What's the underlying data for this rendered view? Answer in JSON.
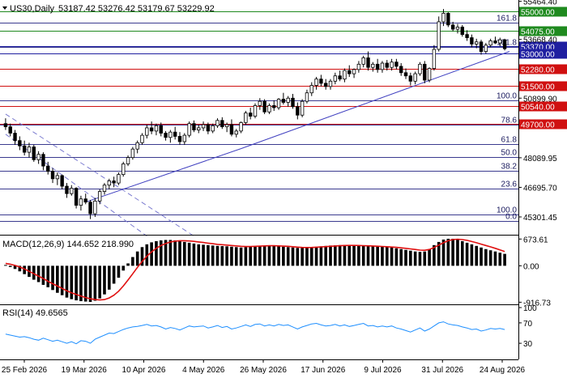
{
  "chart_data": {
    "type": "candlestick",
    "symbol_label": "US30,Daily",
    "ohlc_label": "53187.42 53276.42 53179.67 53229.92",
    "price_axis": {
      "range": [
        44500,
        55450
      ],
      "ticks": [
        {
          "value": 55464.4,
          "label": "55464.40"
        },
        {
          "value": 53668.4,
          "label": "53668.40"
        },
        {
          "value": 50899.9,
          "label": "50899.90"
        },
        {
          "value": 48089.95,
          "label": "48089.95"
        },
        {
          "value": 46695.7,
          "label": "46695.70"
        },
        {
          "value": 45301.45,
          "label": "45301.45"
        }
      ]
    },
    "horizontal_levels": [
      {
        "value": 55000,
        "label": "55000.00",
        "color": "#1f8a1f"
      },
      {
        "value": 54075,
        "label": "54075.00",
        "color": "#1f8a1f"
      },
      {
        "value": 53370,
        "label": "53370.00",
        "color": "#1f1fa0"
      },
      {
        "value": 53000,
        "label": "53000.00",
        "color": "#1f1fa0"
      },
      {
        "value": 52280,
        "label": "52280.00",
        "color": "#d01010"
      },
      {
        "value": 51500,
        "label": "51500.00",
        "color": "#d01010"
      },
      {
        "value": 50540,
        "label": "50540.00",
        "color": "#d01010"
      },
      {
        "value": 49700,
        "label": "49700.00",
        "color": "#d01010"
      }
    ],
    "fibonacci_levels": [
      {
        "label": "161.8",
        "value": 54450
      },
      {
        "label": "161.8",
        "value": 53330
      },
      {
        "label": "100.0",
        "value": 50780
      },
      {
        "label": "78.6",
        "value": 49640
      },
      {
        "label": "61.8",
        "value": 48730
      },
      {
        "label": "50.0",
        "value": 48110
      },
      {
        "label": "38.2",
        "value": 47460
      },
      {
        "label": "23.6",
        "value": 46640
      },
      {
        "label": "100.0",
        "value": 45420
      },
      {
        "label": "0.0",
        "value": 45110
      }
    ],
    "x_axis": {
      "labels": [
        "25 Feb 2026",
        "19 Mar 2026",
        "10 Apr 2026",
        "4 May 2026",
        "26 May 2026",
        "17 Jun 2026",
        "9 Jul 2026",
        "31 Jul 2026",
        "24 Aug 2026"
      ]
    },
    "candles": [
      [
        49700,
        49950,
        49400,
        49550
      ],
      [
        49550,
        49700,
        49100,
        49250
      ],
      [
        49250,
        49400,
        48700,
        48900
      ],
      [
        48900,
        49100,
        48450,
        48650
      ],
      [
        48650,
        48900,
        48200,
        48350
      ],
      [
        48350,
        48800,
        48100,
        48600
      ],
      [
        48600,
        48700,
        47900,
        48000
      ],
      [
        48000,
        48400,
        47800,
        48250
      ],
      [
        48250,
        48350,
        47500,
        47700
      ],
      [
        47700,
        47900,
        47300,
        47450
      ],
      [
        47450,
        47600,
        46900,
        47100
      ],
      [
        47100,
        47400,
        46800,
        47250
      ],
      [
        47250,
        47300,
        46600,
        46750
      ],
      [
        46750,
        46900,
        46200,
        46400
      ],
      [
        46400,
        46800,
        46300,
        46650
      ],
      [
        46650,
        46700,
        45700,
        45850
      ],
      [
        45850,
        46300,
        45600,
        46150
      ],
      [
        46150,
        46400,
        45900,
        46000
      ],
      [
        46000,
        46100,
        45200,
        45450
      ],
      [
        45450,
        46200,
        45300,
        46050
      ],
      [
        46050,
        46600,
        45900,
        46500
      ],
      [
        46500,
        46900,
        46350,
        46800
      ],
      [
        46800,
        47100,
        46600,
        47000
      ],
      [
        47000,
        47200,
        46700,
        46900
      ],
      [
        46900,
        47400,
        46800,
        47300
      ],
      [
        47300,
        47900,
        47200,
        47800
      ],
      [
        47800,
        48200,
        47700,
        48100
      ],
      [
        48100,
        48600,
        48000,
        48500
      ],
      [
        48500,
        48900,
        48300,
        48800
      ],
      [
        48800,
        49250,
        48700,
        49150
      ],
      [
        49150,
        49650,
        49000,
        49500
      ],
      [
        49500,
        49800,
        49200,
        49350
      ],
      [
        49350,
        49700,
        49150,
        49600
      ],
      [
        49600,
        49750,
        49100,
        49250
      ],
      [
        49250,
        49350,
        48900,
        49050
      ],
      [
        49050,
        49400,
        48800,
        49300
      ],
      [
        49300,
        49550,
        48950,
        49100
      ],
      [
        49100,
        49300,
        48700,
        48850
      ],
      [
        48850,
        49250,
        48700,
        49150
      ],
      [
        49150,
        49800,
        49050,
        49700
      ],
      [
        49700,
        49850,
        49300,
        49400
      ],
      [
        49400,
        49650,
        49250,
        49500
      ],
      [
        49500,
        49800,
        49350,
        49650
      ],
      [
        49650,
        49750,
        49200,
        49350
      ],
      [
        49350,
        49700,
        49250,
        49600
      ],
      [
        49600,
        49950,
        49500,
        49850
      ],
      [
        49850,
        50000,
        49450,
        49550
      ],
      [
        49550,
        49750,
        49300,
        49650
      ],
      [
        49650,
        49900,
        49100,
        49200
      ],
      [
        49200,
        49450,
        49050,
        49350
      ],
      [
        49350,
        49800,
        49250,
        49750
      ],
      [
        49750,
        50300,
        49650,
        50200
      ],
      [
        50200,
        50450,
        49900,
        50050
      ],
      [
        50050,
        50650,
        49950,
        50550
      ],
      [
        50550,
        50900,
        50350,
        50750
      ],
      [
        50750,
        50850,
        50150,
        50250
      ],
      [
        50250,
        50650,
        50150,
        50550
      ],
      [
        50550,
        50800,
        50300,
        50450
      ],
      [
        50450,
        50900,
        50350,
        50850
      ],
      [
        50850,
        51150,
        50600,
        50700
      ],
      [
        50700,
        51000,
        50500,
        50900
      ],
      [
        50900,
        51100,
        50400,
        50500
      ],
      [
        50500,
        50700,
        49900,
        50100
      ],
      [
        50100,
        50850,
        50000,
        50750
      ],
      [
        50750,
        51300,
        50650,
        51150
      ],
      [
        51150,
        51650,
        51000,
        51500
      ],
      [
        51500,
        51900,
        51300,
        51800
      ],
      [
        51800,
        52000,
        51450,
        51600
      ],
      [
        51600,
        51800,
        51300,
        51450
      ],
      [
        51450,
        51800,
        51300,
        51700
      ],
      [
        51700,
        52100,
        51550,
        51950
      ],
      [
        51950,
        52200,
        51700,
        51800
      ],
      [
        51800,
        52300,
        51650,
        52200
      ],
      [
        52200,
        52450,
        51900,
        52050
      ],
      [
        52050,
        52300,
        51850,
        52250
      ],
      [
        52250,
        52650,
        52100,
        52500
      ],
      [
        52500,
        52900,
        52350,
        52800
      ],
      [
        52800,
        53100,
        52200,
        52350
      ],
      [
        52350,
        52600,
        52150,
        52500
      ],
      [
        52500,
        52750,
        52100,
        52250
      ],
      [
        52250,
        52650,
        52100,
        52550
      ],
      [
        52550,
        52700,
        52200,
        52350
      ],
      [
        52350,
        52750,
        52200,
        52600
      ],
      [
        52600,
        52750,
        52250,
        52400
      ],
      [
        52400,
        52550,
        51950,
        52100
      ],
      [
        52100,
        52300,
        51800,
        51950
      ],
      [
        51950,
        52100,
        51500,
        51700
      ],
      [
        51700,
        52150,
        51550,
        52050
      ],
      [
        52050,
        52600,
        51950,
        52500
      ],
      [
        52500,
        52650,
        51600,
        51750
      ],
      [
        51750,
        52350,
        51650,
        52300
      ],
      [
        52300,
        53400,
        52200,
        53200
      ],
      [
        53200,
        54750,
        53100,
        54500
      ],
      [
        54500,
        55100,
        54300,
        54900
      ],
      [
        54900,
        54950,
        54250,
        54350
      ],
      [
        54350,
        54500,
        54050,
        54150
      ],
      [
        54150,
        54400,
        53950,
        54250
      ],
      [
        54250,
        54350,
        53800,
        53900
      ],
      [
        53900,
        54100,
        53600,
        53750
      ],
      [
        53750,
        53900,
        53300,
        53450
      ],
      [
        53450,
        53700,
        53250,
        53550
      ],
      [
        53550,
        53650,
        52950,
        53100
      ],
      [
        53100,
        53500,
        53000,
        53400
      ],
      [
        53400,
        53700,
        53300,
        53600
      ],
      [
        53600,
        53800,
        53450,
        53500
      ],
      [
        53500,
        53750,
        53350,
        53650
      ],
      [
        53650,
        53700,
        53150,
        53230
      ]
    ],
    "trendlines": [
      {
        "from": [
          17,
          46000
        ],
        "to": [
          50,
          48520
        ]
      },
      {
        "from": [
          50,
          48520
        ],
        "to": [
          107,
          53100
        ]
      }
    ],
    "channel_lines": [
      {
        "from": [
          0,
          50150
        ],
        "to": [
          40,
          44400
        ]
      },
      {
        "from": [
          0,
          49200
        ],
        "to": [
          30,
          44400
        ]
      }
    ],
    "macd": {
      "label": "MACD(12,26,9) 144.652 218.990",
      "range": [
        -950,
        700
      ],
      "ticks": [
        {
          "value": 673.61,
          "label": "673.61"
        },
        {
          "value": 0,
          "label": "0.00"
        },
        {
          "value": -916.73,
          "label": "-916.73"
        }
      ],
      "histogram": [
        20,
        -30,
        -80,
        -140,
        -210,
        -280,
        -350,
        -410,
        -480,
        -540,
        -610,
        -680,
        -740,
        -800,
        -840,
        -870,
        -890,
        -900,
        -910,
        -880,
        -820,
        -720,
        -600,
        -450,
        -300,
        -120,
        60,
        220,
        360,
        470,
        540,
        590,
        620,
        640,
        650,
        650,
        640,
        620,
        600,
        580,
        560,
        540,
        530,
        520,
        510,
        500,
        495,
        490,
        480,
        470,
        460,
        470,
        480,
        490,
        500,
        505,
        510,
        500,
        490,
        480,
        470,
        460,
        450,
        450,
        460,
        470,
        480,
        490,
        500,
        510,
        515,
        520,
        525,
        520,
        515,
        510,
        505,
        500,
        495,
        490,
        480,
        470,
        460,
        440,
        420,
        400,
        380,
        360,
        350,
        360,
        420,
        520,
        600,
        660,
        680,
        680,
        660,
        620,
        580,
        540,
        500,
        460,
        420,
        390,
        360,
        330,
        300
      ],
      "signal": [
        60,
        40,
        10,
        -30,
        -80,
        -140,
        -200,
        -260,
        -320,
        -390,
        -450,
        -510,
        -570,
        -630,
        -680,
        -720,
        -760,
        -800,
        -830,
        -850,
        -860,
        -850,
        -810,
        -740,
        -640,
        -510,
        -360,
        -200,
        -40,
        110,
        240,
        350,
        440,
        510,
        560,
        600,
        620,
        630,
        630,
        625,
        615,
        600,
        585,
        570,
        555,
        540,
        530,
        520,
        510,
        500,
        490,
        485,
        485,
        490,
        495,
        500,
        505,
        505,
        500,
        495,
        490,
        480,
        470,
        462,
        460,
        462,
        468,
        475,
        483,
        490,
        498,
        505,
        510,
        512,
        512,
        510,
        507,
        503,
        498,
        493,
        487,
        480,
        472,
        463,
        452,
        440,
        425,
        410,
        395,
        390,
        410,
        460,
        520,
        580,
        630,
        660,
        670,
        660,
        640,
        610,
        580,
        545,
        510,
        475,
        440,
        400,
        360
      ]
    },
    "rsi": {
      "label": "RSI(14) 49.6565",
      "range": [
        0,
        100
      ],
      "ticks": [
        {
          "value": 100,
          "label": "100"
        },
        {
          "value": 70,
          "label": "70"
        },
        {
          "value": 30,
          "label": "30"
        }
      ],
      "values": [
        48,
        46,
        44,
        42,
        43,
        41,
        38,
        36,
        40,
        37,
        34,
        36,
        33,
        30,
        33,
        29,
        35,
        34,
        30,
        38,
        42,
        46,
        50,
        49,
        53,
        57,
        60,
        62,
        63,
        65,
        67,
        64,
        65,
        62,
        58,
        61,
        59,
        56,
        60,
        64,
        62,
        63,
        64,
        60,
        62,
        65,
        61,
        63,
        58,
        60,
        63,
        66,
        63,
        67,
        68,
        64,
        66,
        64,
        67,
        65,
        66,
        62,
        58,
        62,
        65,
        68,
        69,
        66,
        64,
        65,
        67,
        64,
        66,
        63,
        65,
        67,
        69,
        64,
        65,
        62,
        64,
        62,
        64,
        60,
        58,
        55,
        52,
        56,
        60,
        54,
        58,
        64,
        70,
        72,
        68,
        66,
        65,
        62,
        60,
        57,
        58,
        54,
        56,
        59,
        58,
        59,
        57
      ]
    }
  }
}
